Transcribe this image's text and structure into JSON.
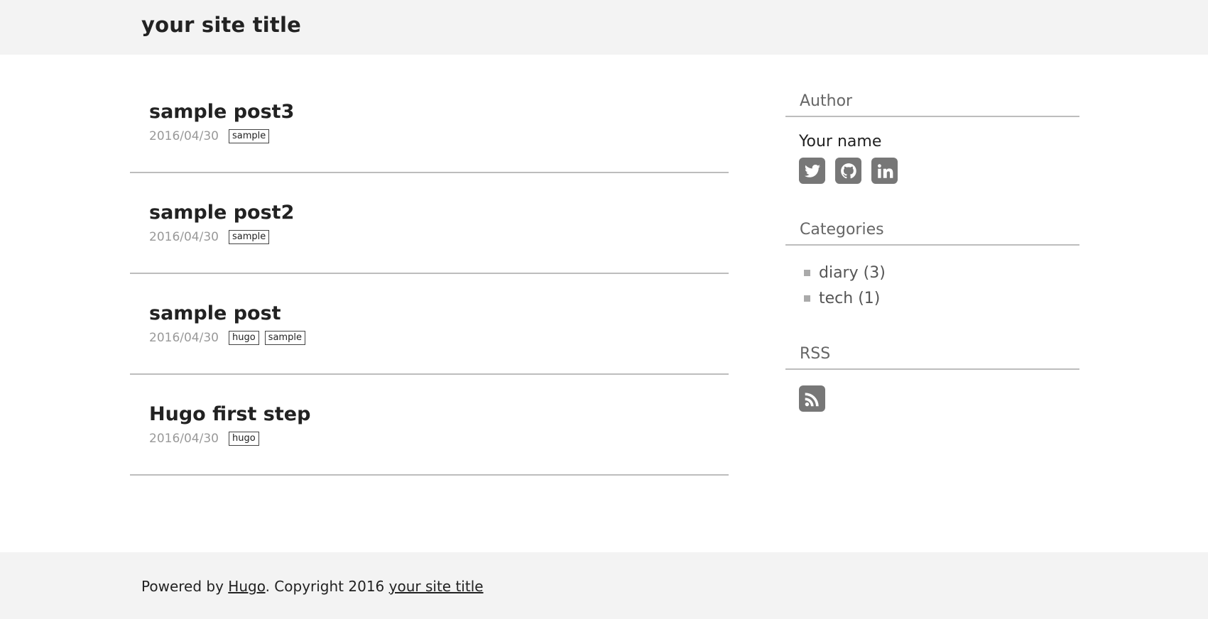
{
  "header": {
    "site_title": "your site title"
  },
  "posts": [
    {
      "title": "sample post3",
      "date": "2016/04/30",
      "tags": [
        "sample"
      ]
    },
    {
      "title": "sample post2",
      "date": "2016/04/30",
      "tags": [
        "sample"
      ]
    },
    {
      "title": "sample post",
      "date": "2016/04/30",
      "tags": [
        "hugo",
        "sample"
      ]
    },
    {
      "title": "Hugo first step",
      "date": "2016/04/30",
      "tags": [
        "hugo"
      ]
    }
  ],
  "sidebar": {
    "author": {
      "title": "Author",
      "name": "Your name",
      "icons": [
        "twitter-icon",
        "github-icon",
        "linkedin-icon"
      ]
    },
    "categories": {
      "title": "Categories",
      "items": [
        {
          "label": "diary (3)"
        },
        {
          "label": "tech (1)"
        }
      ]
    },
    "rss": {
      "title": "RSS",
      "icon": "rss-icon"
    }
  },
  "footer": {
    "prefix": "Powered by ",
    "hugo_link": "Hugo",
    "middle": ". Copyright 2016 ",
    "site_link": "your site title"
  },
  "colors": {
    "header_bg": "#f3f3f3",
    "icon_bg": "#777777",
    "divider": "#bdbdbd"
  }
}
